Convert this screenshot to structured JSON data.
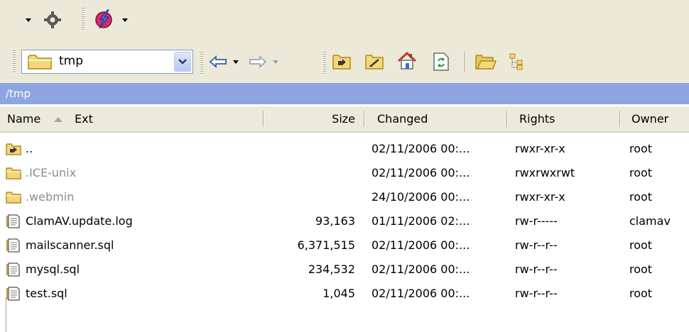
{
  "path": "/tmp",
  "location": {
    "folder": "tmp"
  },
  "columns": {
    "name": "Name",
    "ext": "Ext",
    "size": "Size",
    "changed": "Changed",
    "rights": "Rights",
    "owner": "Owner"
  },
  "rows": [
    {
      "name": "..",
      "size": "",
      "changed": "02/11/2006 00:...",
      "rights": "rwxr-xr-x",
      "owner": "root",
      "type": "parent-folder"
    },
    {
      "name": ".ICE-unix",
      "size": "",
      "changed": "02/11/2006 00:...",
      "rights": "rwxrwxrwt",
      "owner": "root",
      "type": "hidden-folder"
    },
    {
      "name": ".webmin",
      "size": "",
      "changed": "24/10/2006 00:...",
      "rights": "rwxr-xr-x",
      "owner": "root",
      "type": "hidden-folder"
    },
    {
      "name": "ClamAV.update.log",
      "size": "93,163",
      "changed": "01/11/2006 02:...",
      "rights": "rw-r-----",
      "owner": "clamav",
      "type": "file"
    },
    {
      "name": "mailscanner.sql",
      "size": "6,371,515",
      "changed": "02/11/2006 00:...",
      "rights": "rw-r--r--",
      "owner": "root",
      "type": "file"
    },
    {
      "name": "mysql.sql",
      "size": "234,532",
      "changed": "02/11/2006 00:...",
      "rights": "rw-r--r--",
      "owner": "root",
      "type": "file"
    },
    {
      "name": "test.sql",
      "size": "1,045",
      "changed": "02/11/2006 00:...",
      "rights": "rw-r--r--",
      "owner": "root",
      "type": "file"
    }
  ],
  "colors": {
    "toolbar_bg": "#ece9d8",
    "path_bar": "#8da4e0",
    "hidden_text": "#8c8c8c",
    "folder": "#f4d77a"
  }
}
